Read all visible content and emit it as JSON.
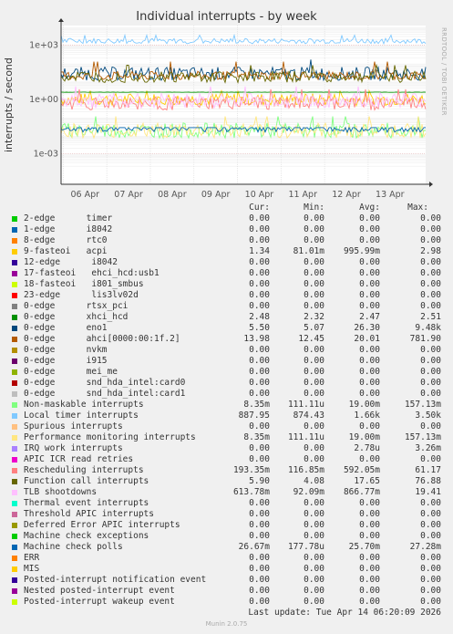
{
  "chart_data": {
    "type": "line",
    "title": "Individual interrupts - by week",
    "ylabel": "interrupts / second",
    "yscale": "log",
    "ylim": [
      2e-05,
      12000
    ],
    "y_ticks": [
      {
        "label": "1e+03",
        "value": 1000
      },
      {
        "label": "1e+00",
        "value": 1
      },
      {
        "label": "1e-03",
        "value": 0.001
      }
    ],
    "x_ticks": [
      "06 Apr",
      "07 Apr",
      "08 Apr",
      "09 Apr",
      "10 Apr",
      "11 Apr",
      "12 Apr",
      "13 Apr"
    ],
    "grid": true,
    "columns": [
      "Cur:",
      "Min:",
      "Avg:",
      "Max:"
    ],
    "series": [
      {
        "name": "2-edge      timer",
        "color": "#00cc00",
        "cur": "0.00",
        "min": "0.00",
        "avg": "0.00",
        "max": "0.00"
      },
      {
        "name": "1-edge      i8042",
        "color": "#0066b3",
        "cur": "0.00",
        "min": "0.00",
        "avg": "0.00",
        "max": "0.00"
      },
      {
        "name": "8-edge      rtc0",
        "color": "#ff8000",
        "cur": "0.00",
        "min": "0.00",
        "avg": "0.00",
        "max": "0.00"
      },
      {
        "name": "9-fasteoi   acpi",
        "color": "#ffcc00",
        "cur": "1.34",
        "min": "81.01m",
        "avg": "995.99m",
        "max": "2.98"
      },
      {
        "name": "12-edge      i8042",
        "color": "#330099",
        "cur": "0.00",
        "min": "0.00",
        "avg": "0.00",
        "max": "0.00"
      },
      {
        "name": "17-fasteoi   ehci_hcd:usb1",
        "color": "#990099",
        "cur": "0.00",
        "min": "0.00",
        "avg": "0.00",
        "max": "0.00"
      },
      {
        "name": "18-fasteoi   i801_smbus",
        "color": "#ccff00",
        "cur": "0.00",
        "min": "0.00",
        "avg": "0.00",
        "max": "0.00"
      },
      {
        "name": "23-edge      lis3lv02d",
        "color": "#ff0000",
        "cur": "0.00",
        "min": "0.00",
        "avg": "0.00",
        "max": "0.00"
      },
      {
        "name": "0-edge      rtsx_pci",
        "color": "#808080",
        "cur": "0.00",
        "min": "0.00",
        "avg": "0.00",
        "max": "0.00"
      },
      {
        "name": "0-edge      xhci_hcd",
        "color": "#008f00",
        "cur": "2.48",
        "min": "2.32",
        "avg": "2.47",
        "max": "2.51"
      },
      {
        "name": "0-edge      eno1",
        "color": "#00487d",
        "cur": "5.50",
        "min": "5.07",
        "avg": "26.30",
        "max": "9.48k"
      },
      {
        "name": "0-edge      ahci[0000:00:1f.2]",
        "color": "#b35a00",
        "cur": "13.98",
        "min": "12.45",
        "avg": "20.01",
        "max": "781.90"
      },
      {
        "name": "0-edge      nvkm",
        "color": "#b38f00",
        "cur": "0.00",
        "min": "0.00",
        "avg": "0.00",
        "max": "0.00"
      },
      {
        "name": "0-edge      i915",
        "color": "#6b006b",
        "cur": "0.00",
        "min": "0.00",
        "avg": "0.00",
        "max": "0.00"
      },
      {
        "name": "0-edge      mei_me",
        "color": "#8fb300",
        "cur": "0.00",
        "min": "0.00",
        "avg": "0.00",
        "max": "0.00"
      },
      {
        "name": "0-edge      snd_hda_intel:card0",
        "color": "#b30000",
        "cur": "0.00",
        "min": "0.00",
        "avg": "0.00",
        "max": "0.00"
      },
      {
        "name": "0-edge      snd_hda_intel:card1",
        "color": "#bebebe",
        "cur": "0.00",
        "min": "0.00",
        "avg": "0.00",
        "max": "0.00"
      },
      {
        "name": "Non-maskable interrupts",
        "color": "#80ff80",
        "cur": "8.35m",
        "min": "111.11u",
        "avg": "19.00m",
        "max": "157.13m"
      },
      {
        "name": "Local timer interrupts",
        "color": "#80c9ff",
        "cur": "887.95",
        "min": "874.43",
        "avg": "1.66k",
        "max": "3.50k"
      },
      {
        "name": "Spurious interrupts",
        "color": "#ffc080",
        "cur": "0.00",
        "min": "0.00",
        "avg": "0.00",
        "max": "0.00"
      },
      {
        "name": "Performance monitoring interrupts",
        "color": "#ffe680",
        "cur": "8.35m",
        "min": "111.11u",
        "avg": "19.00m",
        "max": "157.13m"
      },
      {
        "name": "IRQ work interrupts",
        "color": "#aa80ff",
        "cur": "0.00",
        "min": "0.00",
        "avg": "2.78u",
        "max": "3.26m"
      },
      {
        "name": "APIC ICR read retries",
        "color": "#ee00cc",
        "cur": "0.00",
        "min": "0.00",
        "avg": "0.00",
        "max": "0.00"
      },
      {
        "name": "Rescheduling interrupts",
        "color": "#ff8080",
        "cur": "193.35m",
        "min": "116.85m",
        "avg": "592.05m",
        "max": "61.17"
      },
      {
        "name": "Function call interrupts",
        "color": "#666600",
        "cur": "5.90",
        "min": "4.08",
        "avg": "17.65",
        "max": "76.88"
      },
      {
        "name": "TLB shootdowns",
        "color": "#ffbfff",
        "cur": "613.78m",
        "min": "92.09m",
        "avg": "866.77m",
        "max": "19.41"
      },
      {
        "name": "Thermal event interrupts",
        "color": "#00ffcc",
        "cur": "0.00",
        "min": "0.00",
        "avg": "0.00",
        "max": "0.00"
      },
      {
        "name": "Threshold APIC interrupts",
        "color": "#cc6699",
        "cur": "0.00",
        "min": "0.00",
        "avg": "0.00",
        "max": "0.00"
      },
      {
        "name": "Deferred Error APIC interrupts",
        "color": "#999900",
        "cur": "0.00",
        "min": "0.00",
        "avg": "0.00",
        "max": "0.00"
      },
      {
        "name": "Machine check exceptions",
        "color": "#00cc00",
        "cur": "0.00",
        "min": "0.00",
        "avg": "0.00",
        "max": "0.00"
      },
      {
        "name": "Machine check polls",
        "color": "#0066b3",
        "cur": "26.67m",
        "min": "177.78u",
        "avg": "25.70m",
        "max": "27.28m"
      },
      {
        "name": "ERR",
        "color": "#ff8000",
        "cur": "0.00",
        "min": "0.00",
        "avg": "0.00",
        "max": "0.00"
      },
      {
        "name": "MIS",
        "color": "#ffcc00",
        "cur": "0.00",
        "min": "0.00",
        "avg": "0.00",
        "max": "0.00"
      },
      {
        "name": "Posted-interrupt notification event",
        "color": "#330099",
        "cur": "0.00",
        "min": "0.00",
        "avg": "0.00",
        "max": "0.00"
      },
      {
        "name": "Nested posted-interrupt event",
        "color": "#990099",
        "cur": "0.00",
        "min": "0.00",
        "avg": "0.00",
        "max": "0.00"
      },
      {
        "name": "Posted-interrupt wakeup event",
        "color": "#ccff00",
        "cur": "0.00",
        "min": "0.00",
        "avg": "0.00",
        "max": "0.00"
      }
    ]
  },
  "side_label": "RRDTOOL / TOBI OETIKER",
  "last_update": "Last update: Tue Apr 14 06:20:09 2026",
  "footer": "Munin 2.0.75"
}
